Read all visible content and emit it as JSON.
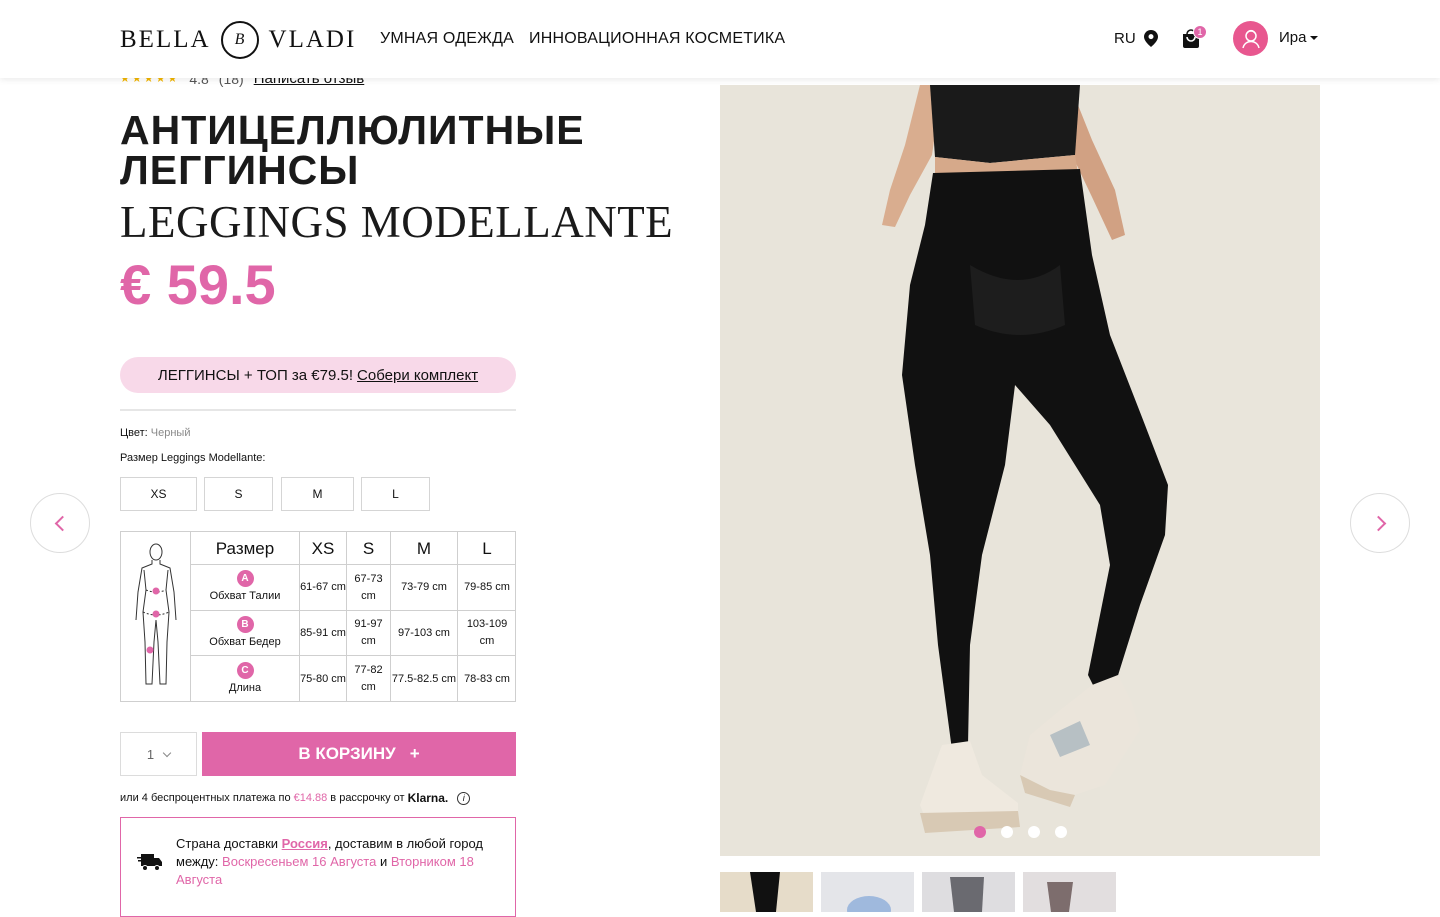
{
  "header": {
    "logo_left": "BELLA",
    "logo_mark": "B",
    "logo_right": "VLADI",
    "nav": [
      "УМНАЯ ОДЕЖДА",
      "ИННОВАЦИОННАЯ КОСМЕТИКА"
    ],
    "lang": "RU",
    "cart_count": "1",
    "user_name": "Ира"
  },
  "product": {
    "rating": "4.8",
    "reviews_count": "(18)",
    "write_review": "Написать отзыв",
    "stars": "★★★★★",
    "title_ru": "АНТИЦЕЛЛЮЛИТНЫЕ ЛЕГГИНСЫ",
    "title_it": "LEGGINGS MODELLANTE",
    "price": "€ 59.5",
    "bundle_text": "ЛЕГГИНСЫ + ТОП за €79.5!",
    "bundle_link": "Собери комплект",
    "color_label": "Цвет:",
    "color_value": "Черный",
    "size_label": "Размер Leggings Modellante:",
    "sizes": [
      "XS",
      "S",
      "M",
      "L"
    ]
  },
  "size_table": {
    "header": [
      "Размер",
      "XS",
      "S",
      "M",
      "L"
    ],
    "rows": [
      {
        "badge": "A",
        "label": "Обхват Талии",
        "values": [
          "61-67 cm",
          "67-73 cm",
          "73-79 cm",
          "79-85 cm"
        ]
      },
      {
        "badge": "B",
        "label": "Обхват Бедер",
        "values": [
          "85-91 cm",
          "91-97 cm",
          "97-103 cm",
          "103-109 cm"
        ]
      },
      {
        "badge": "C",
        "label": "Длина",
        "values": [
          "75-80 cm",
          "77-82 cm",
          "77.5-82.5 cm",
          "78-83 cm"
        ]
      }
    ]
  },
  "purchase": {
    "quantity": "1",
    "add_to_cart": "В КОРЗИНУ",
    "add_plus": "+",
    "klarna_prefix": "или 4 беспроцентных платежа по",
    "klarna_amount": "€14.88",
    "klarna_mid": "в рассрочку от",
    "klarna_brand": "Klarna."
  },
  "delivery": {
    "prefix": "Страна доставки",
    "country": "Россия",
    "middle": ", доставим в любой город между:",
    "date1": "Воскресеньем 16 Августа",
    "and": "и",
    "date2": "Вторником 18 Августа"
  },
  "carousel": {
    "slides_count": 4,
    "active_slide": 1
  },
  "colors": {
    "accent": "#e066a8",
    "bundle_bg": "#f8d9e9",
    "photo_bg": "#e8e4da"
  }
}
